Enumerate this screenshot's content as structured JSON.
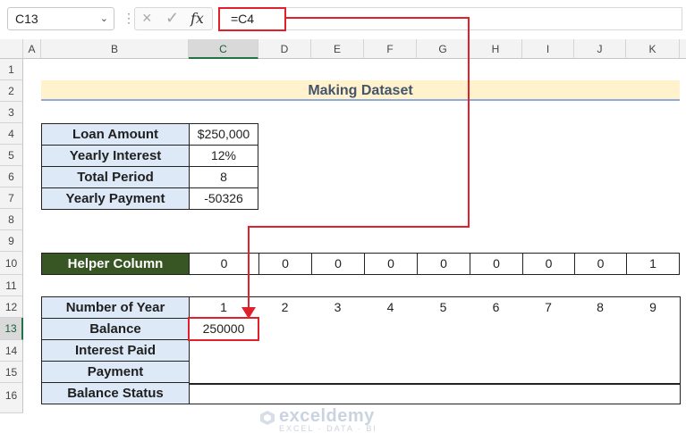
{
  "formula_bar": {
    "name_box": "C13",
    "cancel_icon": "×",
    "enter_icon": "✓",
    "fx_label": "fx",
    "formula": "=C4"
  },
  "columns": [
    "A",
    "B",
    "C",
    "D",
    "E",
    "F",
    "G",
    "H",
    "I",
    "J",
    "K"
  ],
  "rows": [
    "1",
    "2",
    "3",
    "4",
    "5",
    "6",
    "7",
    "8",
    "9",
    "10",
    "11",
    "12",
    "13",
    "14",
    "15",
    "16"
  ],
  "title": "Making Dataset",
  "loan_table": [
    {
      "label": "Loan Amount",
      "value": "$250,000"
    },
    {
      "label": "Yearly Interest",
      "value": "12%"
    },
    {
      "label": "Total Period",
      "value": "8"
    },
    {
      "label": "Yearly Payment",
      "value": "-50326"
    }
  ],
  "helper": {
    "label": "Helper Column",
    "values": [
      "0",
      "0",
      "0",
      "0",
      "0",
      "0",
      "0",
      "0",
      "1"
    ]
  },
  "schedule": {
    "labels": [
      "Number of Year",
      "Balance",
      "Interest Paid",
      "Payment",
      "Balance Status"
    ],
    "years": [
      "1",
      "2",
      "3",
      "4",
      "5",
      "6",
      "7",
      "8",
      "9"
    ],
    "balance_first": "250000"
  },
  "watermark": {
    "brand": "exceldemy",
    "tagline": "EXCEL · DATA · BI"
  },
  "colors": {
    "accent_red": "#e0212b",
    "label_fill": "#dde9f7",
    "helper_fill": "#375623",
    "title_fill": "#fff2cc"
  }
}
